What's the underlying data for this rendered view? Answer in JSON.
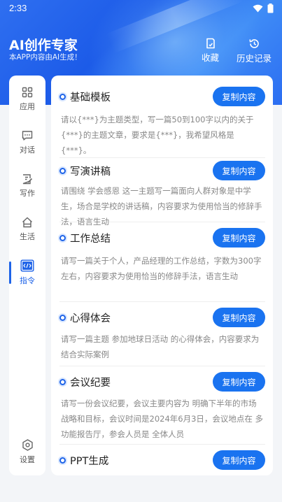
{
  "status": {
    "time": "2:33"
  },
  "header": {
    "title": "AI创作专家",
    "subtitle": "本APP内容由AI生成！",
    "favorites_label": "收藏",
    "history_label": "历史记录"
  },
  "sidebar": {
    "items": [
      {
        "label": "应用",
        "icon": "grid-icon"
      },
      {
        "label": "对话",
        "icon": "chat-icon"
      },
      {
        "label": "写作",
        "icon": "write-icon"
      },
      {
        "label": "生活",
        "icon": "home-icon"
      },
      {
        "label": "指令",
        "icon": "command-icon",
        "active": true
      }
    ],
    "settings_label": "设置"
  },
  "copy_label": "复制内容",
  "cards": [
    {
      "title": "基础模板",
      "desc": "请以{***}为主题类型，写一篇50到100字以内的关于{***}的主题文章，要求是{***}，我希望风格是{***}。"
    },
    {
      "title": "写演讲稿",
      "desc": "请围绕 学会感恩 这一主题写一篇面向人群对象是中学生，场合是学校的讲话稿，内容要求为使用恰当的修辞手法，语言生动"
    },
    {
      "title": "工作总结",
      "desc": "请写一篇关于个人，产品经理的工作总结，字数为300字左右，内容要求为使用恰当的修辞手法，语言生动"
    },
    {
      "title": "心得体会",
      "desc": "请写一篇主题 参加地球日活动 的心得体会，内容要求为 结合实际案例"
    },
    {
      "title": "会议纪要",
      "desc": "请写一份会议纪要，会议主要内容为 明确下半年的市场战略和目标，会议时间是2024年6月3日，会议地点在 多功能报告厅，参会人员是 全体人员"
    },
    {
      "title": "PPT生成",
      "desc": ""
    }
  ]
}
